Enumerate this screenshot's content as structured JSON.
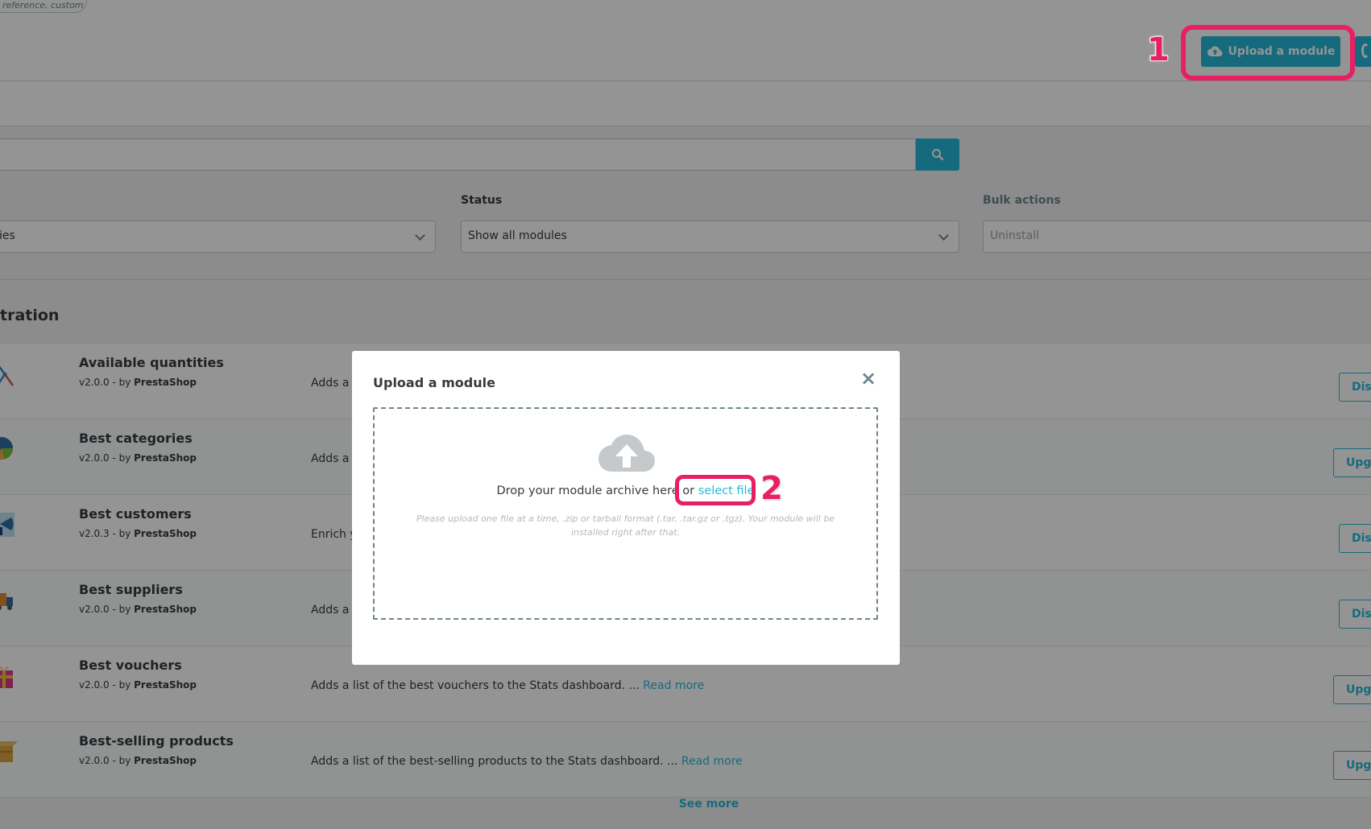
{
  "header": {
    "search_chip_text": "reference, custom",
    "upload_button_label": "Upload a module"
  },
  "filters": {
    "category_value": "ies",
    "status_label": "Status",
    "status_value": "Show all modules",
    "bulk_label": "Bulk actions",
    "bulk_placeholder": "Uninstall"
  },
  "section": {
    "title": "tration"
  },
  "modules": [
    {
      "name": "Available quantities",
      "version": "v2.0.0 - by",
      "author": "PrestaShop",
      "desc": "Adds a t",
      "read_more": "",
      "action": "Disa",
      "icon": "chart-line-icon"
    },
    {
      "name": "Best categories",
      "version": "v2.0.0 - by",
      "author": "PrestaShop",
      "desc": "Adds a l",
      "read_more": "",
      "action": "Upgr",
      "icon": "pie-chart-icon"
    },
    {
      "name": "Best customers",
      "version": "v2.0.3 - by",
      "author": "PrestaShop",
      "desc": "Enrich y",
      "read_more": "",
      "action": "Disa",
      "icon": "customers-chart-icon"
    },
    {
      "name": "Best suppliers",
      "version": "v2.0.0 - by",
      "author": "PrestaShop",
      "desc": "Adds a l",
      "read_more": "",
      "action": "Disa",
      "icon": "truck-icon"
    },
    {
      "name": "Best vouchers",
      "version": "v2.0.0 - by",
      "author": "PrestaShop",
      "desc": "Adds a list of the best vouchers to the Stats dashboard. ...",
      "read_more": "Read more",
      "action": "Upgr",
      "icon": "gift-icon"
    },
    {
      "name": "Best-selling products",
      "version": "v2.0.0 - by",
      "author": "PrestaShop",
      "desc": "Adds a list of the best-selling products to the Stats dashboard. ...",
      "read_more": "Read more",
      "action": "Upgr",
      "icon": "box-icon"
    }
  ],
  "see_more": "See more",
  "modal": {
    "title": "Upload a module",
    "close": "×",
    "drop_text": "Drop your module archive here or",
    "select_file": "select file",
    "hint": "Please upload one file at a time, .zip or tarball format (.tar, .tar.gz or .tgz). Your module will be installed right after that."
  },
  "annotations": {
    "step1": "1",
    "step2": "2"
  },
  "colors": {
    "accent": "#25b9d7",
    "annotation": "#e81f63"
  }
}
